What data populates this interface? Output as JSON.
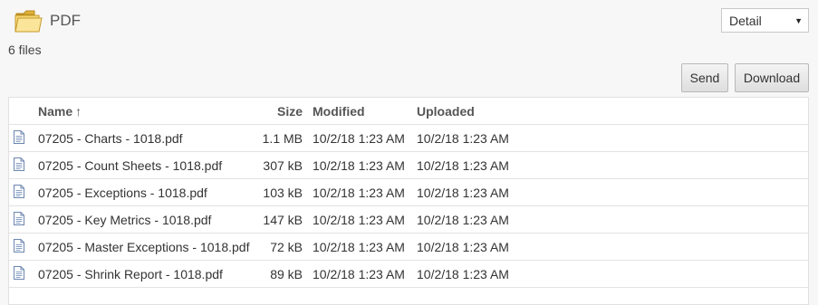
{
  "folder": {
    "title": "PDF",
    "icon": "folder-icon"
  },
  "file_count": "6 files",
  "view_select": {
    "value": "Detail",
    "options": [
      "Detail"
    ]
  },
  "toolbar": {
    "send_label": "Send",
    "download_label": "Download"
  },
  "table": {
    "headers": {
      "name": "Name",
      "sort_indicator": "↑",
      "size": "Size",
      "modified": "Modified",
      "uploaded": "Uploaded"
    },
    "rows": [
      {
        "name": "07205 - Charts - 1018.pdf",
        "size": "1.1 MB",
        "modified": "10/2/18 1:23 AM",
        "uploaded": "10/2/18 1:23 AM",
        "icon": "document-icon"
      },
      {
        "name": "07205 - Count Sheets - 1018.pdf",
        "size": "307 kB",
        "modified": "10/2/18 1:23 AM",
        "uploaded": "10/2/18 1:23 AM",
        "icon": "document-icon"
      },
      {
        "name": "07205 - Exceptions - 1018.pdf",
        "size": "103 kB",
        "modified": "10/2/18 1:23 AM",
        "uploaded": "10/2/18 1:23 AM",
        "icon": "document-icon"
      },
      {
        "name": "07205 - Key Metrics - 1018.pdf",
        "size": "147 kB",
        "modified": "10/2/18 1:23 AM",
        "uploaded": "10/2/18 1:23 AM",
        "icon": "document-icon"
      },
      {
        "name": "07205 - Master Exceptions - 1018.pdf",
        "size": "72 kB",
        "modified": "10/2/18 1:23 AM",
        "uploaded": "10/2/18 1:23 AM",
        "icon": "document-icon"
      },
      {
        "name": "07205 - Shrink Report - 1018.pdf",
        "size": "89 kB",
        "modified": "10/2/18 1:23 AM",
        "uploaded": "10/2/18 1:23 AM",
        "icon": "document-icon"
      }
    ]
  },
  "colors": {
    "background": "#f7f7f7",
    "table_bg": "#ffffff",
    "folder": "#f5d36a",
    "doc_icon": "#6b86b0"
  }
}
